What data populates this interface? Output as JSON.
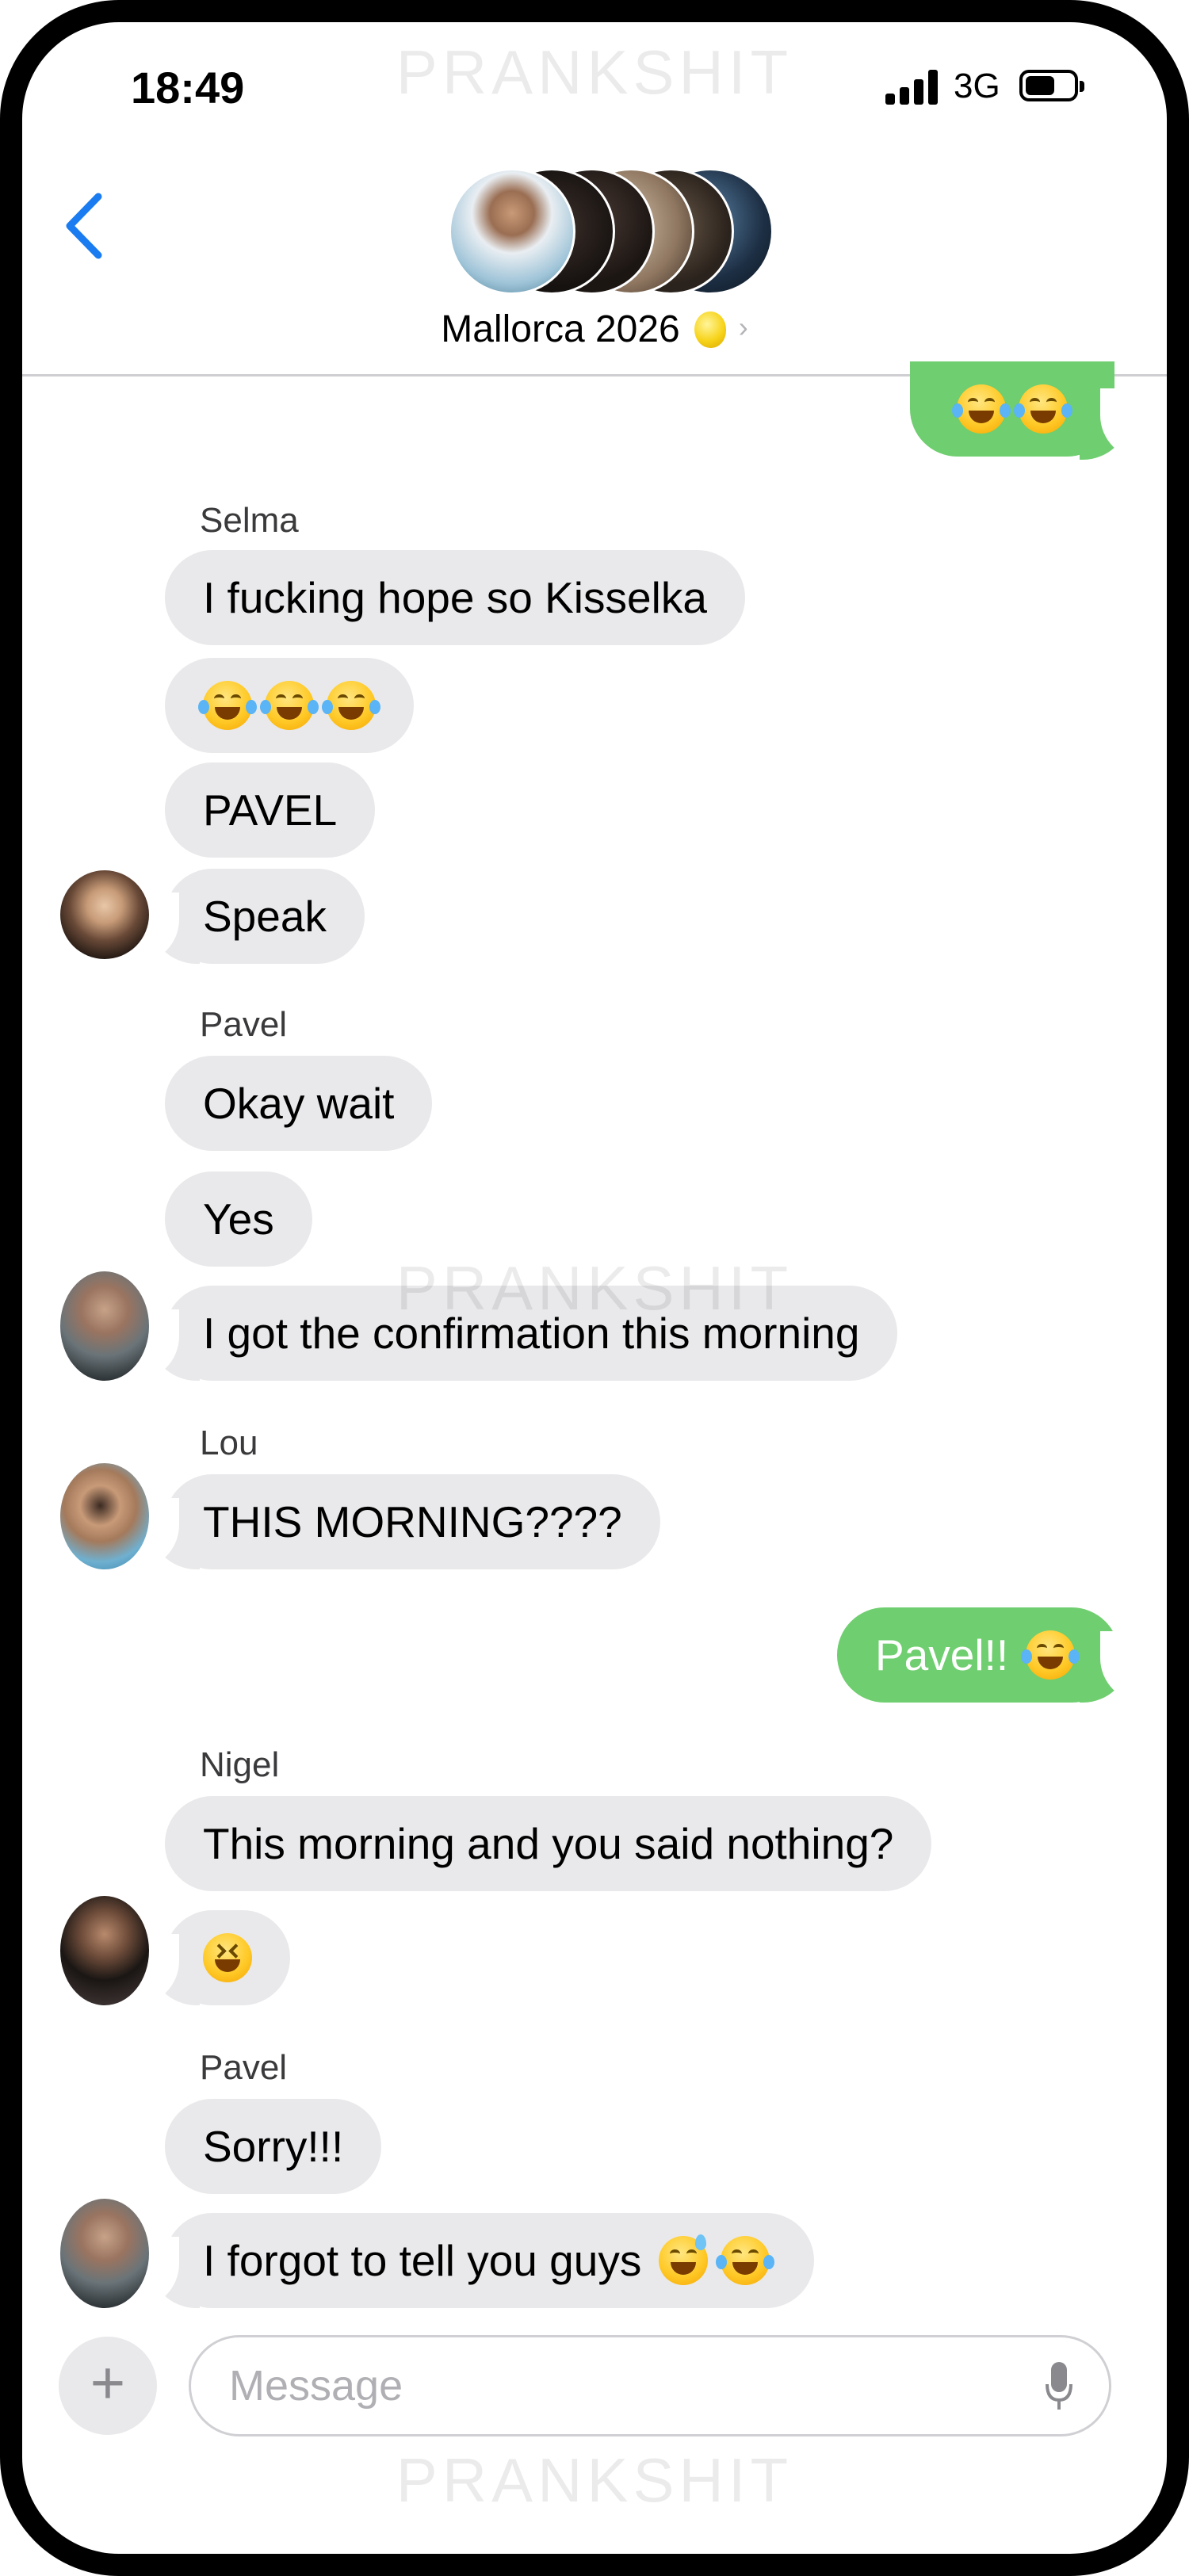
{
  "status_bar": {
    "time": "18:49",
    "network": "3G"
  },
  "watermark": "PRANKSHIT",
  "header": {
    "title": "Mallorca 2026"
  },
  "messages": {
    "m0": {
      "text": ""
    },
    "selma_name": "Selma",
    "m1": "I fucking hope so Kisselka",
    "m3": "PAVEL",
    "m4": "Speak",
    "pavel_name_1": "Pavel",
    "m5": "Okay wait",
    "m6": "Yes",
    "m7": "I got the confirmation this morning",
    "lou_name": "Lou",
    "m8": "THIS MORNING????",
    "m9": "Pavel!!",
    "nigel_name": "Nigel",
    "m10": "This morning and you said nothing?",
    "pavel_name_2": "Pavel",
    "m12": "Sorry!!!",
    "m13": "I forgot to tell you guys"
  },
  "composer": {
    "placeholder": "Message"
  },
  "colors": {
    "outgoing": "#6fce6f",
    "incoming": "#e9e9eb",
    "accent": "#1a7cf0"
  },
  "icons": [
    "back-chevron-icon",
    "signal-icon",
    "battery-icon",
    "plus-icon",
    "microphone-icon",
    "lemon-emoji",
    "tears-of-joy-emoji",
    "sweat-smile-emoji",
    "squinting-laugh-emoji"
  ]
}
